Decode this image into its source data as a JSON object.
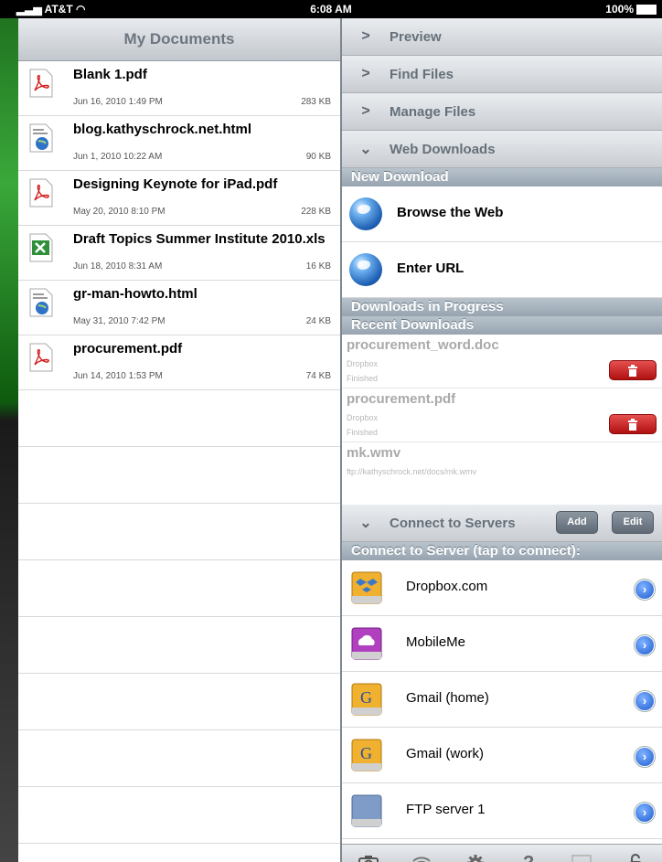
{
  "status_bar": {
    "carrier": "AT&T",
    "time": "6:08 AM",
    "battery": "100%"
  },
  "documents": {
    "title": "My Documents",
    "items": [
      {
        "name": "Blank 1.pdf",
        "date": "Jun 16, 2010 1:49 PM",
        "size": "283 KB",
        "icon": "pdf-icon"
      },
      {
        "name": "blog.kathyschrock.net.html",
        "date": "Jun 1, 2010 10:22 AM",
        "size": "90 KB",
        "icon": "html-file-icon"
      },
      {
        "name": "Designing Keynote for iPad.pdf",
        "date": "May 20, 2010 8:10 PM",
        "size": "228 KB",
        "icon": "pdf-icon"
      },
      {
        "name": "Draft Topics Summer Institute 2010.xls",
        "date": "Jun 18, 2010 8:31 AM",
        "size": "16 KB",
        "icon": "excel-icon"
      },
      {
        "name": "gr-man-howto.html",
        "date": "May 31, 2010 7:42 PM",
        "size": "24 KB",
        "icon": "html-file-icon"
      },
      {
        "name": "procurement.pdf",
        "date": "Jun 14, 2010 1:53 PM",
        "size": "74 KB",
        "icon": "pdf-icon"
      }
    ]
  },
  "sections": {
    "preview": "Preview",
    "find_files": "Find Files",
    "manage_files": "Manage Files",
    "web_downloads": "Web Downloads",
    "connect_servers": "Connect to Servers"
  },
  "web_downloads": {
    "new_download": "New Download",
    "browse": "Browse the Web",
    "enter_url": "Enter URL",
    "in_progress": "Downloads in Progress",
    "recent": "Recent Downloads",
    "items": [
      {
        "name": "procurement_word.doc",
        "source": "Dropbox",
        "status": "Finished"
      },
      {
        "name": "procurement.pdf",
        "source": "Dropbox",
        "status": "Finished"
      },
      {
        "name": "mk.wmv",
        "source": "ftp://kathyschrock.net/docs/mk.wmv",
        "status": ""
      }
    ]
  },
  "servers": {
    "add_label": "Add",
    "edit_label": "Edit",
    "header": "Connect to Server (tap to connect):",
    "items": [
      {
        "name": "Dropbox.com",
        "color": "#f0b030"
      },
      {
        "name": "MobileMe",
        "color": "#b040c0"
      },
      {
        "name": "Gmail (home)",
        "color": "#f0b030"
      },
      {
        "name": "Gmail (work)",
        "color": "#f0b030"
      },
      {
        "name": "FTP server 1",
        "color": "#7f9bc7"
      }
    ]
  },
  "toolbar": {
    "icons": [
      "camera-icon",
      "wifi-icon",
      "gear-icon",
      "help-icon",
      "monitor-icon",
      "lock-icon"
    ],
    "help_glyph": "?"
  }
}
